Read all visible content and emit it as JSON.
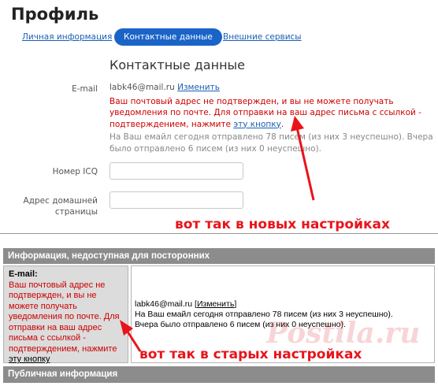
{
  "new_ui": {
    "page_title": "Профиль",
    "tabs": [
      {
        "label": "Личная информация",
        "active": false
      },
      {
        "label": "Контактные данные",
        "active": true
      },
      {
        "label": "Внешние сервисы",
        "active": false
      }
    ],
    "section_title": "Контактные данные",
    "email": {
      "label": "E-mail",
      "value": "labk46@mail.ru",
      "change_link": "Изменить",
      "warning": "Ваш почтовый адрес не подтвержден, и вы не можете получать уведомления по почте. Для отправки на ваш адрес письма с ссылкой - подтверждением, нажмите",
      "warning_link": "эту кнопку",
      "warning_end": ".",
      "info": "На Ваш емайл сегодня отправлено 78 писем (из них 3 неуспешно). Вчера было отправлено 6 писем (из них 0 неуспешно)."
    },
    "icq": {
      "label": "Номер ICQ",
      "value": ""
    },
    "homepage": {
      "label": "Адрес домашней страницы",
      "value": ""
    }
  },
  "annotations": {
    "new": "вот так в новых настройках",
    "old": "вот так в старых настройках"
  },
  "old_ui": {
    "header": "Информация, недоступная для посторонних",
    "email_label": "E-mail:",
    "warning": "Ваш почтовый адрес не подтвержден, и вы не можете получать уведомления по почте. Для отправки на ваш адрес письма с ссылкой - подтверждением, нажмите",
    "warning_link": "эту кнопку",
    "email_value": "labk46@mail.ru",
    "change_open": "[",
    "change_link": "Изменить",
    "change_close": "]",
    "info_today": "На Ваш емайл сегодня отправлено 78 писем (из них 3 неуспешно).",
    "info_yesterday": "Вчера было отправлено 6 писем (из них 0 неуспешно).",
    "footer": "Публичная информация"
  },
  "watermark": "Postila.ru",
  "colors": {
    "accent": "#1a64c8",
    "warning": "#cc0000",
    "annotation": "#e8141b",
    "old_header_bg": "#8c8c8c"
  }
}
